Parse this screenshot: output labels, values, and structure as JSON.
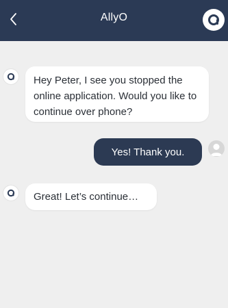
{
  "header": {
    "title": "AllyO",
    "back_icon": "chevron-left-icon",
    "logo_icon": "allyo-logo-icon"
  },
  "messages": [
    {
      "sender": "bot",
      "text": "Hey Peter, I see you stopped the online application. Would you like to continue over phone?"
    },
    {
      "sender": "user",
      "text": "Yes! Thank you."
    },
    {
      "sender": "bot",
      "text": "Great! Let’s continue…"
    }
  ],
  "colors": {
    "header_bg": "#2b3a55",
    "chat_bg": "#efefef",
    "user_bubble": "#2c3a53",
    "bot_bubble": "#ffffff"
  }
}
